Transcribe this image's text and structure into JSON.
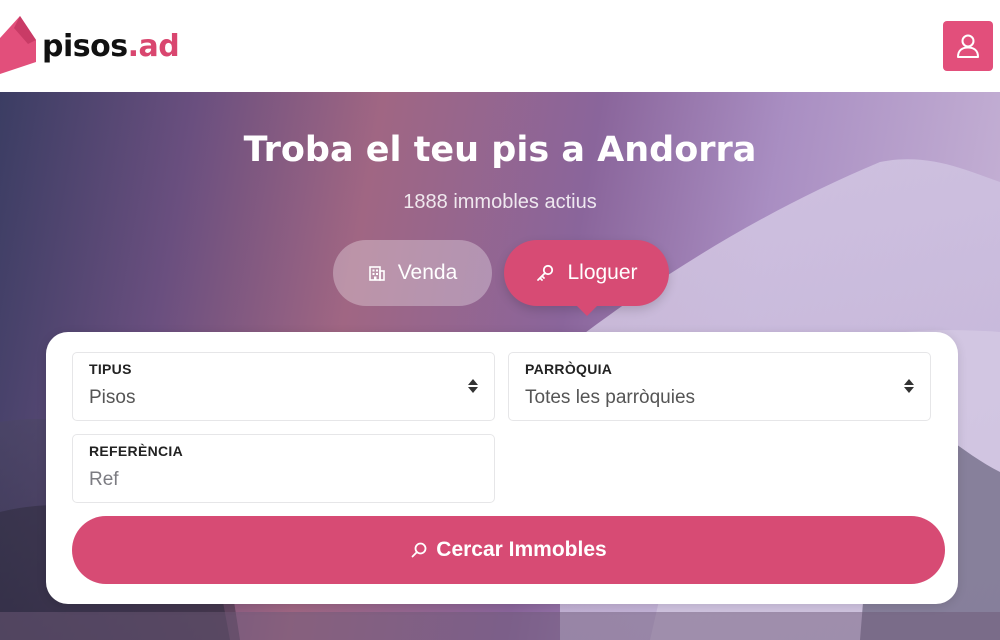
{
  "header": {
    "logo_name": "pisos",
    "logo_domain": ".ad",
    "user_icon": "user-icon"
  },
  "hero": {
    "title": "Troba el teu pis a Andorra",
    "subtitle": "1888 immobles actius"
  },
  "tabs": [
    {
      "label": "Venda",
      "icon": "building-icon",
      "active": false
    },
    {
      "label": "Lloguer",
      "icon": "key-icon",
      "active": true
    }
  ],
  "search": {
    "tipus": {
      "label": "TIPUS",
      "value": "Pisos"
    },
    "parroquia": {
      "label": "PARRÒQUIA",
      "value": "Totes les parròquies"
    },
    "referencia": {
      "label": "REFERÈNCIA",
      "placeholder": "Ref",
      "value": ""
    },
    "button_label": "Cercar Immobles"
  },
  "colors": {
    "accent": "#d74b74",
    "user_button": "#e24f7b"
  }
}
